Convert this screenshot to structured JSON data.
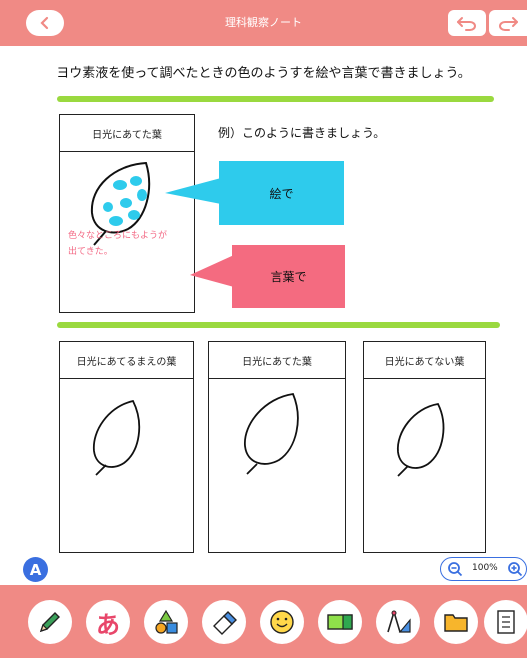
{
  "header": {
    "title": "理科観察ノート",
    "back_icon": "chevron-left-icon",
    "undo_icon": "undo-icon",
    "redo_icon": "redo-icon"
  },
  "instruction": "ヨウ素液を使って調べたときの色のようすを絵や言葉で書きましょう。",
  "example": {
    "box_title": "日光にあてた葉",
    "label": "例）このように書きましょう。",
    "note_line1": "色々なところにもようが",
    "note_line2": "出てきた。",
    "callout_picture": "絵で",
    "callout_words": "言葉で"
  },
  "boxes": [
    {
      "title": "日光にあてるまえの葉"
    },
    {
      "title": "日光にあてた葉"
    },
    {
      "title": "日光にあてない葉"
    }
  ],
  "zoom": {
    "level": "100%",
    "zoom_out_icon": "zoom-out-icon",
    "zoom_in_icon": "zoom-in-icon"
  },
  "badge": "A",
  "toolbar": {
    "tools": [
      "pencil-icon",
      "hiragana-a-icon",
      "shapes-icon",
      "eraser-icon",
      "smiley-icon",
      "sticky-note-icon",
      "compass-ruler-icon",
      "folder-icon",
      "notebook-icon"
    ],
    "hiragana_glyph": "あ"
  },
  "colors": {
    "header": "#f08a85",
    "green_line": "#9ad93f",
    "callout_blue": "#2ecbec",
    "callout_pink": "#f46b80",
    "note_text": "#f36a85",
    "accent_blue": "#3a6fe0"
  }
}
